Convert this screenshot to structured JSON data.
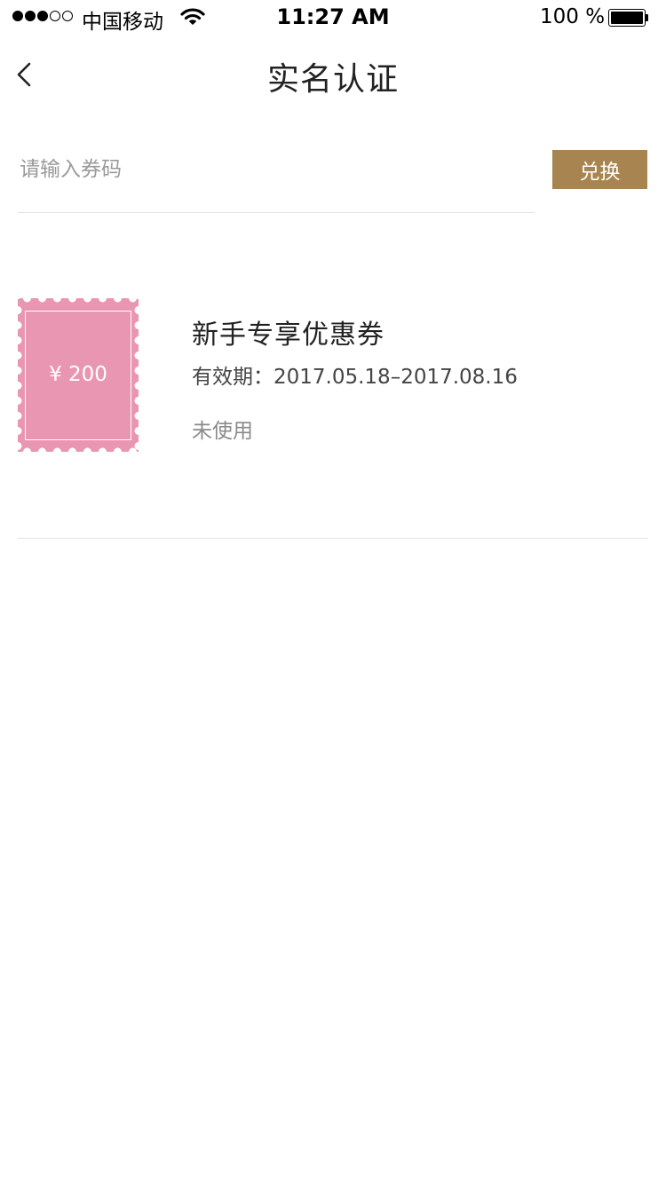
{
  "status_bar": {
    "carrier": "中国移动",
    "time": "11:27 AM",
    "battery_percent": "100 %",
    "signal_bars_filled": 3,
    "signal_bars_total": 5
  },
  "nav": {
    "title": "实名认证",
    "back_icon": "chevron-left-icon"
  },
  "redeem": {
    "placeholder": "请输入券码",
    "value": "",
    "button_label": "兑换",
    "accent_color": "#a88550"
  },
  "coupons": [
    {
      "amount": "¥ 200",
      "title": "新手专享优惠券",
      "validity": "有效期：2017.05.18–2017.08.16",
      "status": "未使用",
      "stamp_color": "#e996b2"
    }
  ]
}
